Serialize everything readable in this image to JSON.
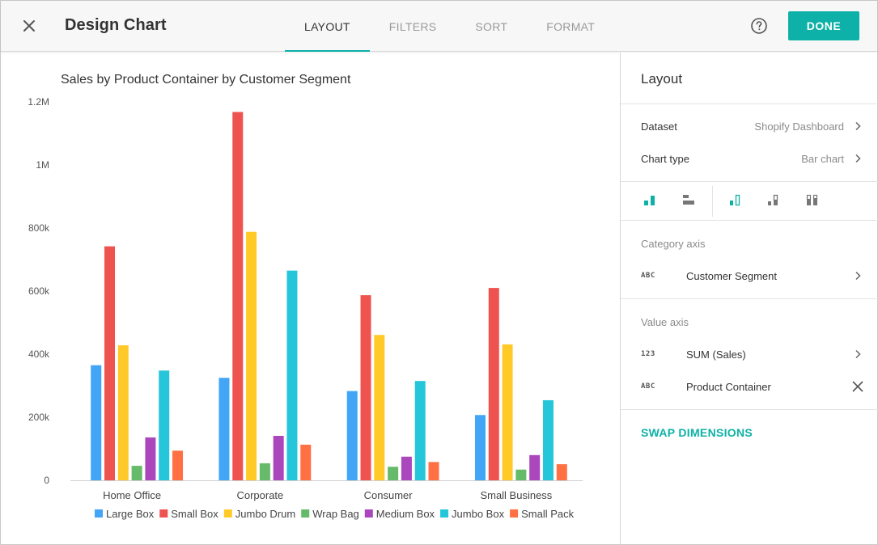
{
  "header": {
    "title": "Design Chart",
    "tabs": [
      {
        "label": "LAYOUT",
        "active": true
      },
      {
        "label": "FILTERS",
        "active": false
      },
      {
        "label": "SORT",
        "active": false
      },
      {
        "label": "FORMAT",
        "active": false
      }
    ],
    "done_label": "DONE",
    "close_icon": "close-icon",
    "help_icon": "help-icon"
  },
  "colors": {
    "accent": "#0db1a7"
  },
  "chart_data": {
    "type": "bar",
    "title": "Sales by Product Container by Customer Segment",
    "xlabel": "",
    "ylabel": "",
    "ylim": [
      0,
      1200000
    ],
    "yticks": [
      {
        "value": 0,
        "label": "0"
      },
      {
        "value": 200000,
        "label": "200k"
      },
      {
        "value": 400000,
        "label": "400k"
      },
      {
        "value": 600000,
        "label": "600k"
      },
      {
        "value": 800000,
        "label": "800k"
      },
      {
        "value": 1000000,
        "label": "1M"
      },
      {
        "value": 1200000,
        "label": "1.2M"
      }
    ],
    "categories": [
      "Home Office",
      "Corporate",
      "Consumer",
      "Small Business"
    ],
    "series": [
      {
        "name": "Large Box",
        "color": "#42a5f5",
        "values": [
          365000,
          325000,
          283000,
          207000
        ]
      },
      {
        "name": "Small Box",
        "color": "#ef5350",
        "values": [
          742000,
          1168000,
          587000,
          610000
        ]
      },
      {
        "name": "Jumbo Drum",
        "color": "#ffca28",
        "values": [
          428000,
          788000,
          461000,
          431000
        ]
      },
      {
        "name": "Wrap Bag",
        "color": "#66bb6a",
        "values": [
          46000,
          54000,
          43000,
          34000
        ]
      },
      {
        "name": "Medium Box",
        "color": "#ab47bc",
        "values": [
          136000,
          141000,
          75000,
          80000
        ]
      },
      {
        "name": "Jumbo Box",
        "color": "#26c6da",
        "values": [
          348000,
          665000,
          315000,
          254000
        ]
      },
      {
        "name": "Small Pack",
        "color": "#ff7043",
        "values": [
          94000,
          113000,
          58000,
          51000
        ]
      }
    ],
    "legend_position": "bottom",
    "grid": false
  },
  "panel": {
    "title": "Layout",
    "dataset_label": "Dataset",
    "dataset_value": "Shopify Dashboard",
    "chart_type_label": "Chart type",
    "chart_type_value": "Bar chart",
    "chart_style_icons": [
      "bar-vertical-icon",
      "bar-horizontal-icon",
      "grouped-bar-icon",
      "stacked-bar-icon",
      "percent-stacked-bar-icon"
    ],
    "category_axis_label": "Category axis",
    "category_field": {
      "type": "ABC",
      "name": "Customer Segment"
    },
    "value_axis_label": "Value axis",
    "value_field": {
      "type": "123",
      "name": "SUM (Sales)"
    },
    "series_field": {
      "type": "ABC",
      "name": "Product Container"
    },
    "swap_label": "SWAP DIMENSIONS"
  }
}
